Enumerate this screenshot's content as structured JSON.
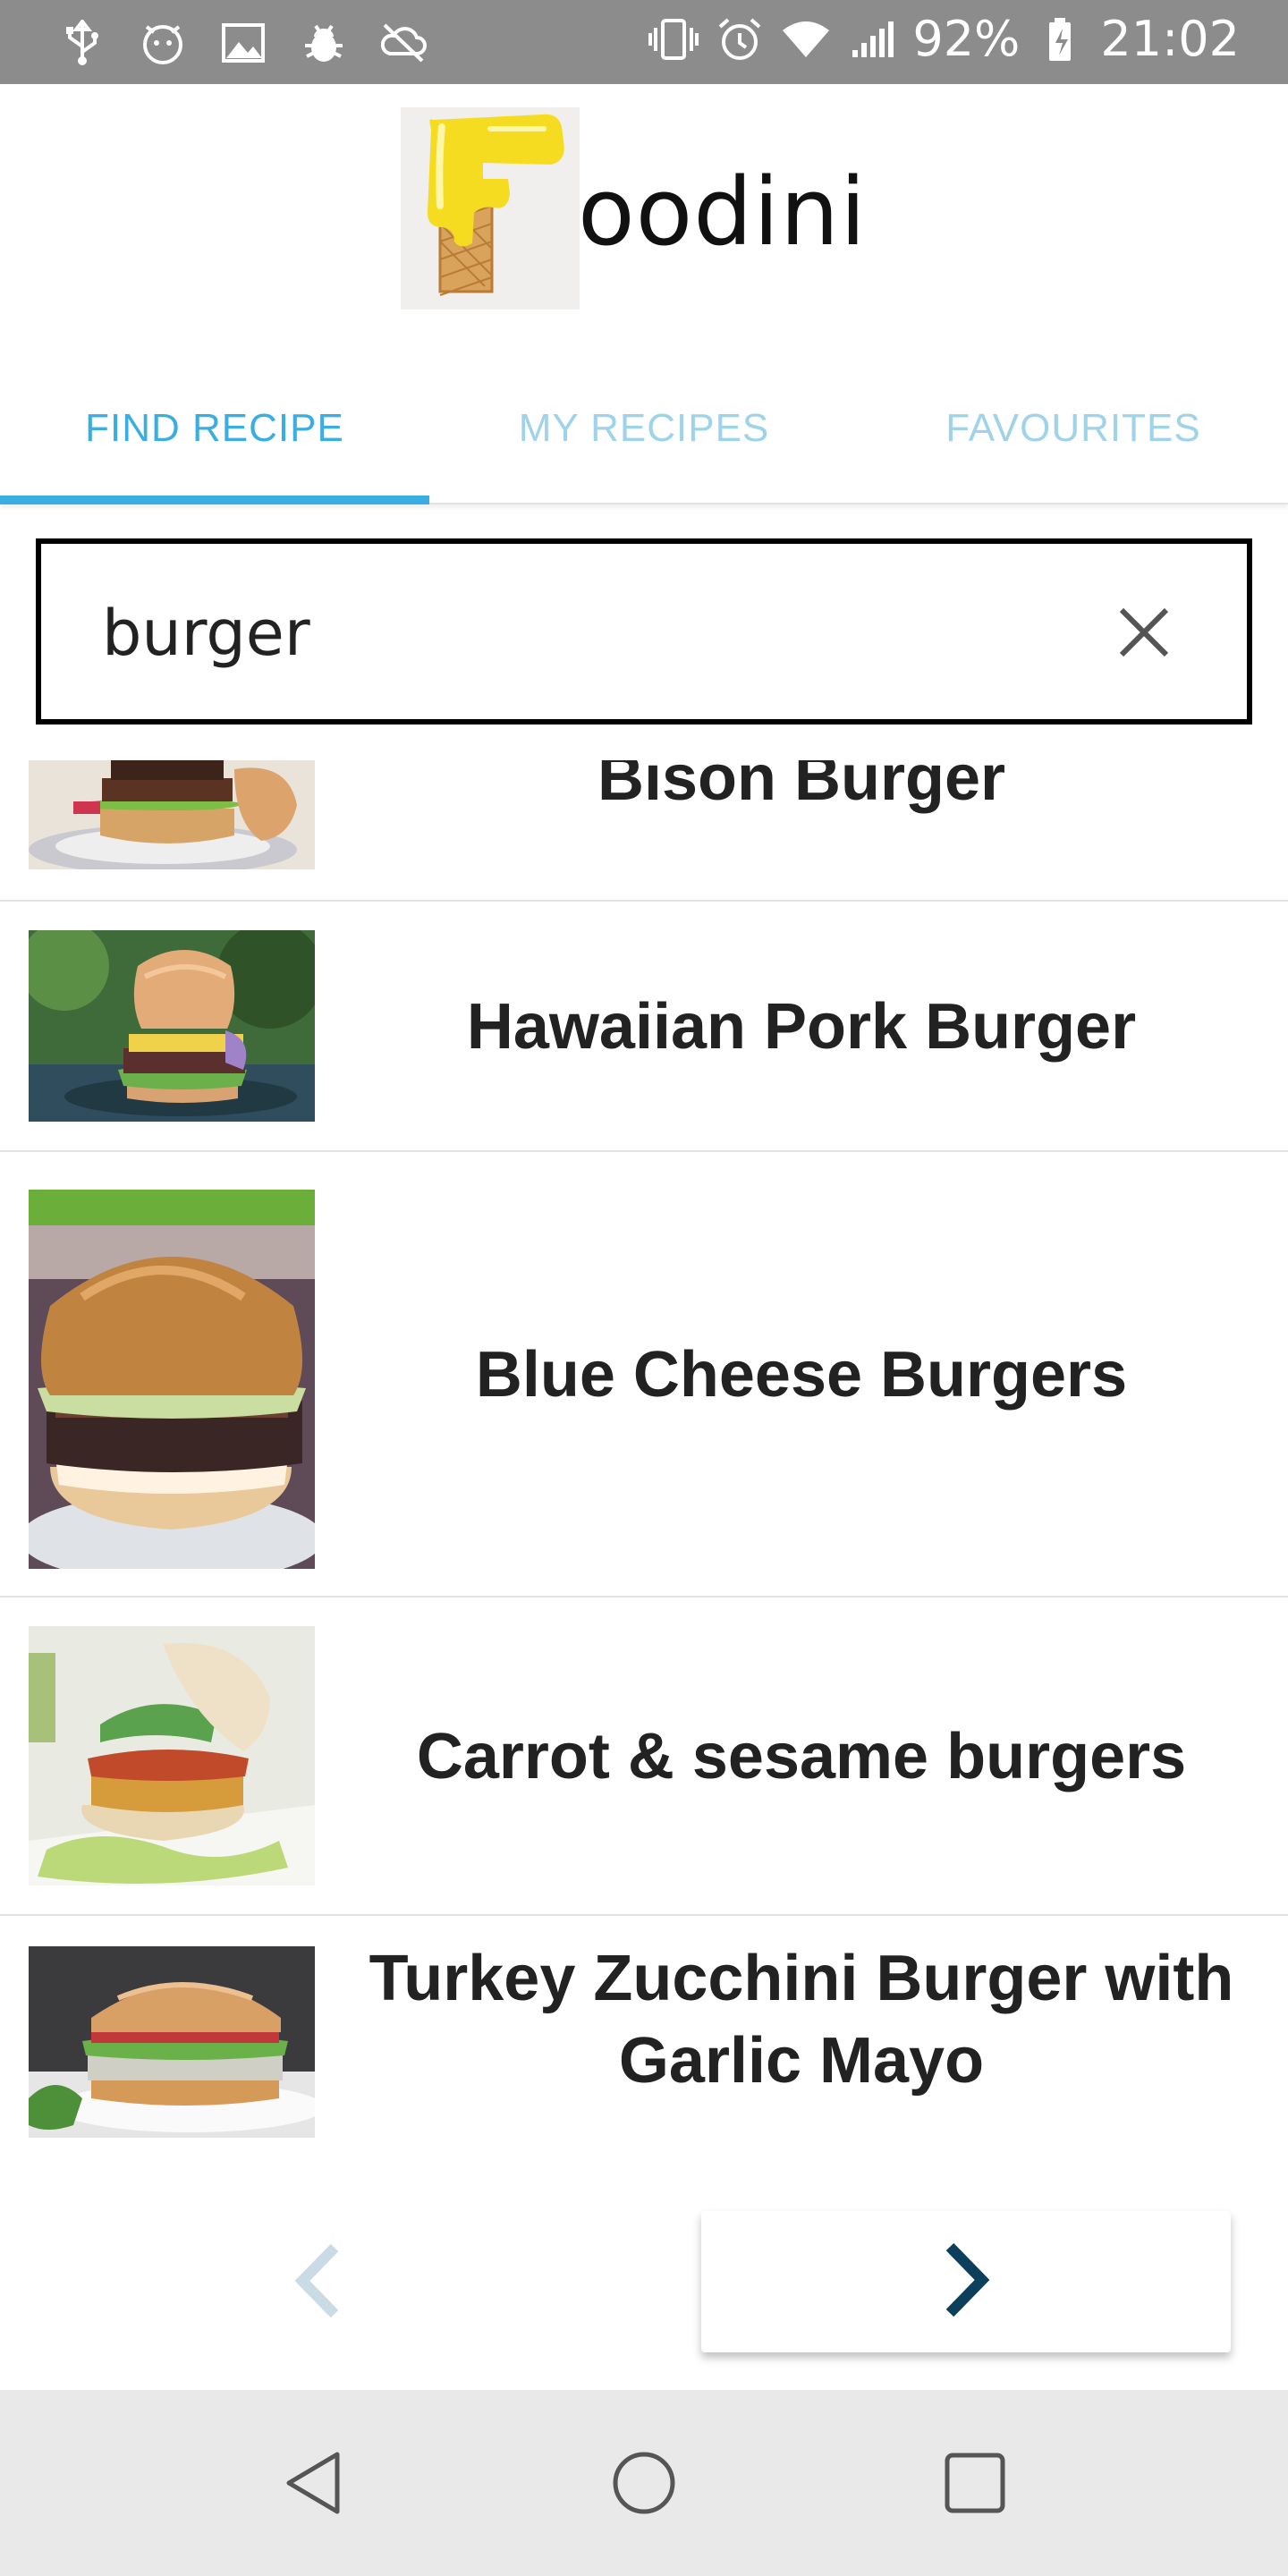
{
  "status_bar": {
    "left_icons": [
      "usb-icon",
      "android-face-icon",
      "image-icon",
      "bug-icon",
      "sync-off-icon"
    ],
    "right_icons": [
      "vibrate-icon",
      "alarm-icon",
      "wifi-icon",
      "signal-icon"
    ],
    "battery": "92%",
    "time": "21:02",
    "background": "#8c8c8c"
  },
  "app": {
    "logo_text": "oodini",
    "logo_icon": "waffle-f-logo"
  },
  "tabs": [
    {
      "label": "FIND RECIPE",
      "active": true
    },
    {
      "label": "MY RECIPES",
      "active": false
    },
    {
      "label": "FAVOURITES",
      "active": false
    }
  ],
  "search": {
    "value": "burger",
    "clear_icon": "close-icon"
  },
  "recipes": [
    {
      "title": "Bison Burger"
    },
    {
      "title": "Hawaiian Pork Burger"
    },
    {
      "title": "Blue Cheese Burgers"
    },
    {
      "title": "Carrot & sesame burgers"
    },
    {
      "title": "Turkey Zucchini Burger with Garlic Mayo"
    }
  ],
  "pager": {
    "prev_icon": "chevron-left-icon",
    "next_icon": "chevron-right-icon"
  },
  "nav": {
    "back_icon": "back-triangle-icon",
    "home_icon": "home-circle-icon",
    "recents_icon": "recents-square-icon"
  },
  "colors": {
    "accent": "#3aaee2",
    "accent_light": "#9fd3ea",
    "next_arrow": "#0c3f5c"
  }
}
